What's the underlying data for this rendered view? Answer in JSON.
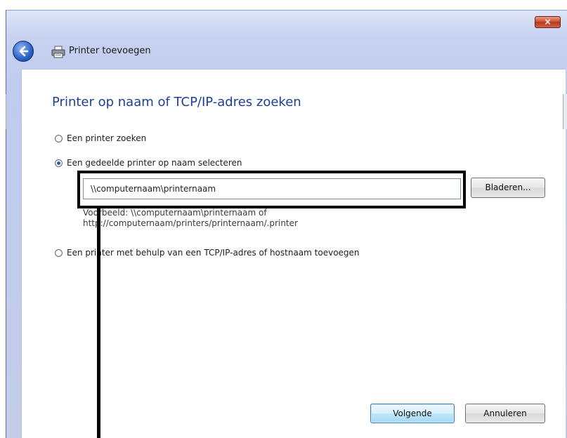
{
  "window": {
    "title": "Printer toevoegen",
    "close_label": "×"
  },
  "page": {
    "heading": "Printer op naam of TCP/IP-adres zoeken"
  },
  "options": [
    {
      "label": "Een printer zoeken",
      "checked": false
    },
    {
      "label": "Een gedeelde printer op naam selecteren",
      "checked": true
    },
    {
      "label": "Een printer met behulp van een TCP/IP-adres of hostnaam toevoegen",
      "checked": false
    }
  ],
  "path_input": {
    "value": "\\\\computernaam\\printernaam"
  },
  "browse_label": "Bladeren...",
  "example": {
    "line1": "Voorbeeld: \\\\computernaam\\printernaam of",
    "line2": "http://computernaam/printers/printernaam/.printer"
  },
  "footer": {
    "next_label": "Volgende",
    "cancel_label": "Annuleren"
  },
  "colors": {
    "heading": "#1f3f93",
    "accent": "#2a5bb7",
    "close": "#c9472b",
    "annotation": "#000000"
  },
  "icons": {
    "back": "back-arrow-icon",
    "printer": "printer-icon",
    "close": "close-icon"
  }
}
